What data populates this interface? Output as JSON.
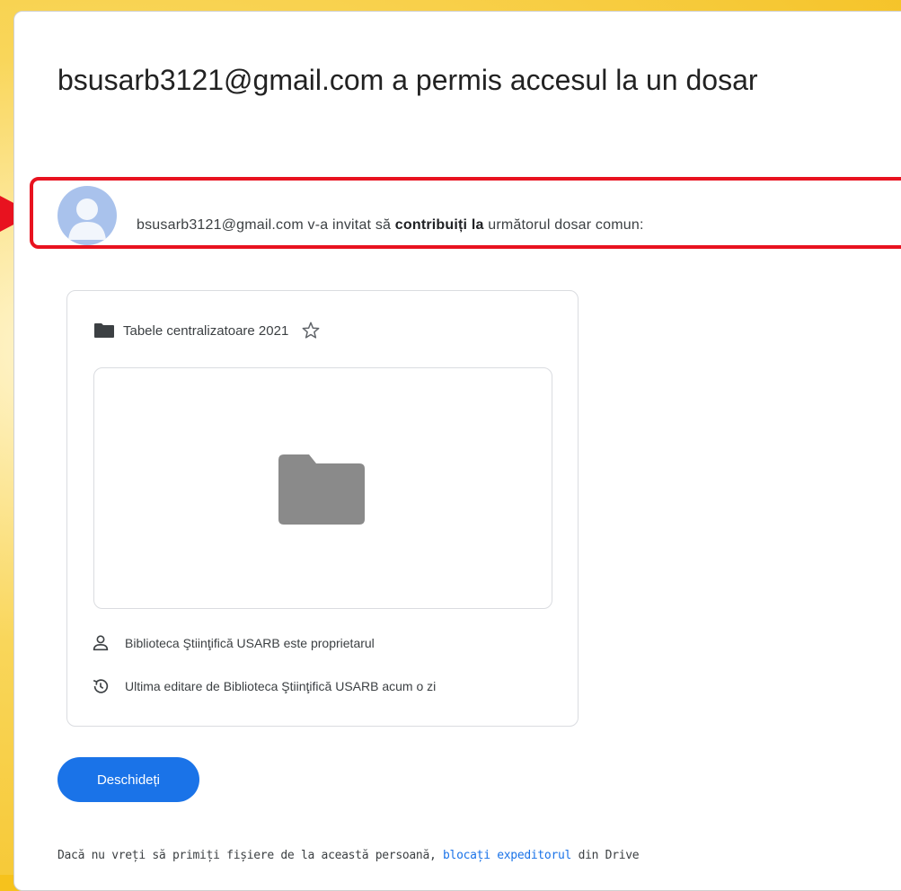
{
  "email": {
    "headline": "bsusarb3121@gmail.com a permis accesul la un dosar",
    "invite": {
      "sender": "bsusarb3121@gmail.com",
      "before": " v-a invitat să ",
      "bold": "contribuiți la",
      "after": " următorul dosar comun:"
    },
    "file": {
      "name": "Tabele centralizatoare 2021",
      "owner_text": "Biblioteca Ştiinţifică USARB este proprietarul",
      "edit_text": "Ultima editare de Biblioteca Ştiinţifică USARB acum o zi"
    },
    "open_button_label": "Deschideți",
    "footer": {
      "before": "Dacă nu vreți să primiți fișiere de la această persoană, ",
      "link": "blocați expeditorul",
      "after": " din Drive"
    }
  },
  "icons": {
    "avatar": "person-avatar-icon",
    "folder": "folder-icon",
    "star": "star-outline-icon",
    "owner": "person-outline-icon",
    "history": "history-icon",
    "arrow": "arrow-right-icon"
  },
  "colors": {
    "highlight": "#e8121f",
    "button": "#1a73e8",
    "link": "#1a73e8",
    "background": "#f6c21c",
    "avatar": "#a9c2ec"
  }
}
